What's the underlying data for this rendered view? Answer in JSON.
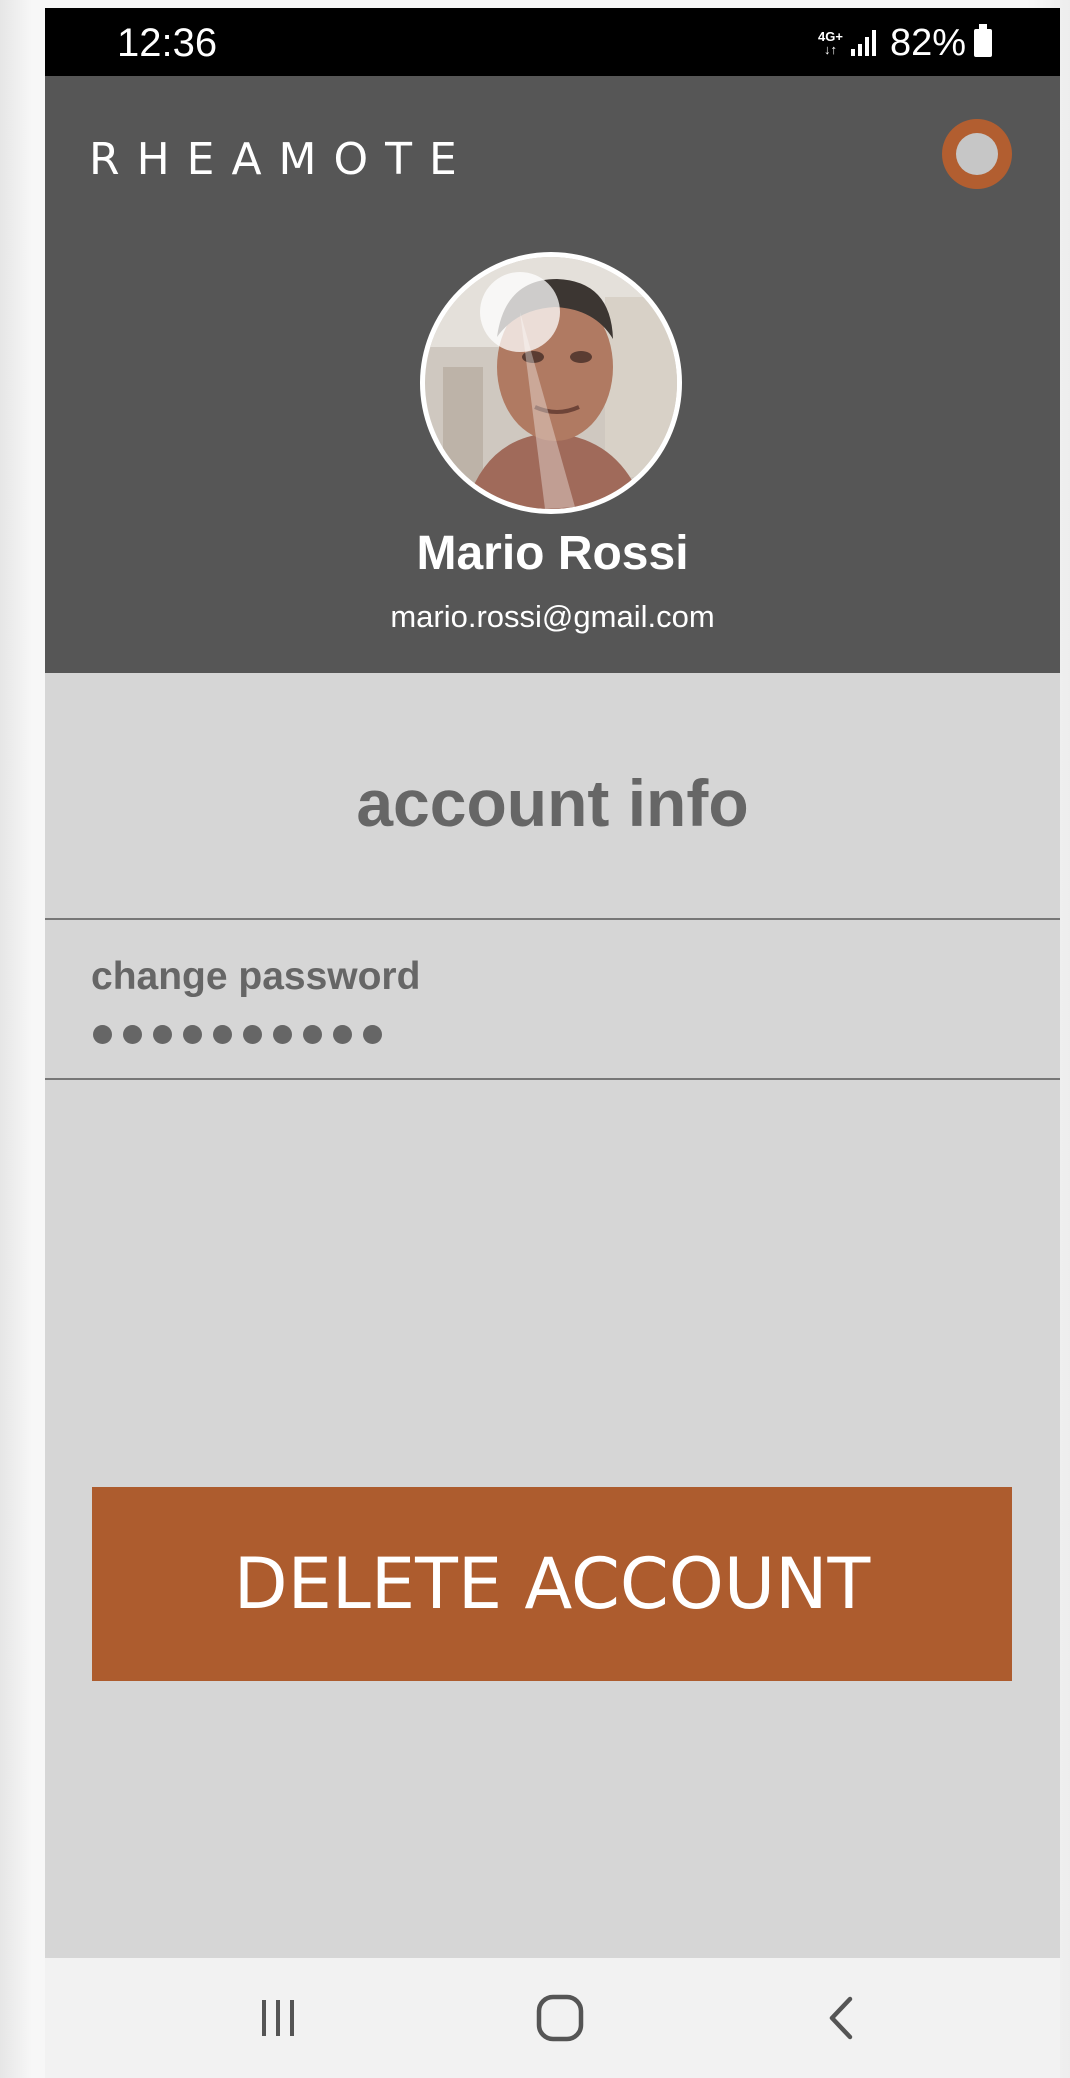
{
  "status_bar": {
    "time": "12:36",
    "network": "4G+",
    "battery": "82%"
  },
  "header": {
    "brand": "RHEAMOTE",
    "profile": {
      "name": "Mario Rossi",
      "email": "mario.rossi@gmail.com"
    }
  },
  "account": {
    "title": "account info",
    "password": {
      "label": "change password",
      "masked_value": "●●●●●●●●●●"
    },
    "delete_label": "DELETE ACCOUNT"
  },
  "colors": {
    "header_bg": "#565656",
    "page_bg": "#d6d6d6",
    "accent": "#ad5c2e",
    "muted_text": "#666666"
  },
  "icons": {
    "toggle": "status-toggle-icon",
    "nav_recents": "recents-icon",
    "nav_home": "home-icon",
    "nav_back": "back-icon"
  }
}
